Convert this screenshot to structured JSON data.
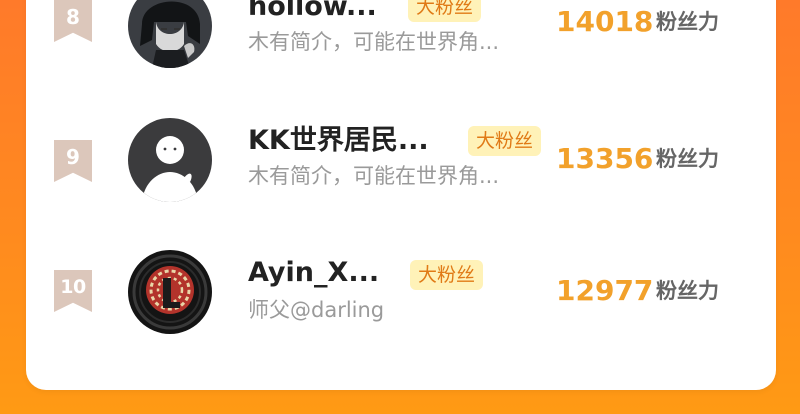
{
  "colors": {
    "background_top": "#ff7a2a",
    "background_bottom": "#ff9a14",
    "score": "#f2a12b",
    "badge_bg": "#fff2b8",
    "badge_text": "#e07a16",
    "rank_badge": "#dcc7bb"
  },
  "entries": [
    {
      "rank": "8",
      "name": "hollow...",
      "badge": "大粉丝",
      "bio": "木有简介，可能在世界角...",
      "score": "14018",
      "score_unit": "粉丝力",
      "avatar_icon": "anime-boy-avatar"
    },
    {
      "rank": "9",
      "name": "KK世界居民...",
      "badge": "大粉丝",
      "bio": "木有简介，可能在世界角...",
      "score": "13356",
      "score_unit": "粉丝力",
      "avatar_icon": "default-person-avatar"
    },
    {
      "rank": "10",
      "name": "Ayin_X...",
      "badge": "大粉丝",
      "bio": "师父@darling",
      "score": "12977",
      "score_unit": "粉丝力",
      "avatar_icon": "brain-logo-avatar"
    }
  ]
}
